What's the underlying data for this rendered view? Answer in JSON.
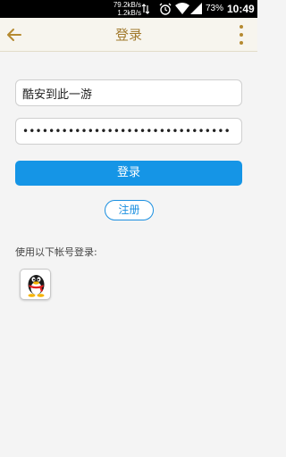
{
  "status_bar": {
    "net_speed_up": "79.2kB/s",
    "net_speed_down": "1.2kB/s",
    "battery_percent": "73%",
    "time": "10:49"
  },
  "header": {
    "title": "登录",
    "accent_color": "#b58a30"
  },
  "form": {
    "username_value": "酷安到此一游",
    "password_masked": "••••••••••••••••••••••••••••••••",
    "login_label": "登录",
    "register_label": "注册"
  },
  "third_party": {
    "label": "使用以下帐号登录:",
    "providers": [
      {
        "icon": "qq-penguin-icon"
      }
    ]
  },
  "colors": {
    "primary_button": "#1595e6",
    "page_background": "#f4f4f4"
  }
}
